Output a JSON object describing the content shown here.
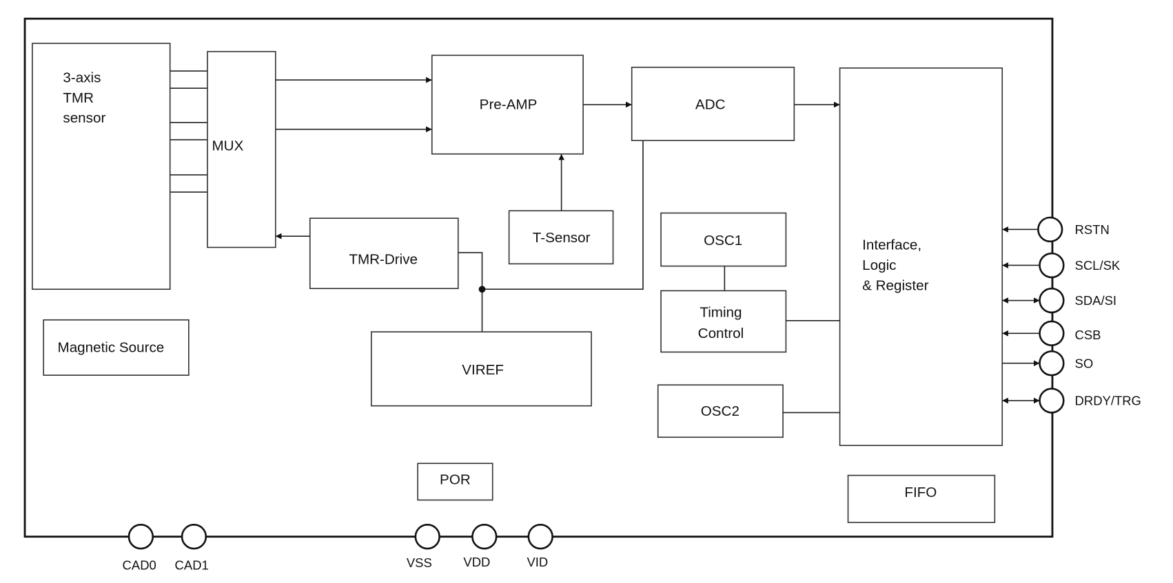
{
  "blocks": {
    "tmr_sensor": [
      "3-axis",
      "TMR",
      "sensor"
    ],
    "mux": "MUX",
    "preamp": "Pre-AMP",
    "adc": "ADC",
    "interface": [
      "Interface,",
      "Logic",
      "& Register"
    ],
    "t_sensor": "T-Sensor",
    "tmr_drive": "TMR-Drive",
    "viref": "VIREF",
    "osc1": "OSC1",
    "timing_control": [
      "Timing",
      "Control"
    ],
    "osc2": "OSC2",
    "magnetic_source": "Magnetic Source",
    "por": "POR",
    "fifo": "FIFO"
  },
  "right_pins": [
    {
      "label": "RSTN",
      "direction": "in"
    },
    {
      "label": "SCL/SK",
      "direction": "in"
    },
    {
      "label": "SDA/SI",
      "direction": "bidirectional"
    },
    {
      "label": "CSB",
      "direction": "in"
    },
    {
      "label": "SO",
      "direction": "out"
    },
    {
      "label": "DRDY/TRG",
      "direction": "bidirectional"
    }
  ],
  "bottom_pins": [
    {
      "label": "CAD0"
    },
    {
      "label": "CAD1"
    },
    {
      "label": "VSS"
    },
    {
      "label": "VDD"
    },
    {
      "label": "VID"
    }
  ]
}
